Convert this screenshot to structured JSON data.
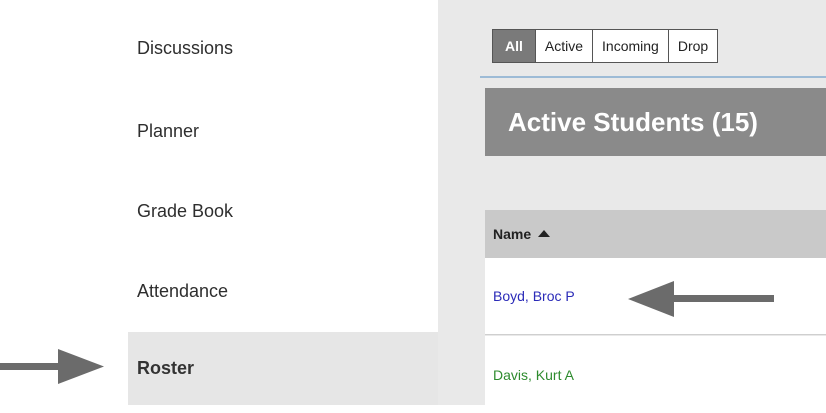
{
  "nav": {
    "items": [
      {
        "label": "Discussions",
        "active": false
      },
      {
        "label": "Planner",
        "active": false
      },
      {
        "label": "Grade Book",
        "active": false
      },
      {
        "label": "Attendance",
        "active": false
      },
      {
        "label": "Roster",
        "active": true
      }
    ]
  },
  "tabs": [
    {
      "label": "All",
      "selected": true
    },
    {
      "label": "Active",
      "selected": false
    },
    {
      "label": "Incoming",
      "selected": false
    },
    {
      "label": "Drop",
      "selected": false
    }
  ],
  "content": {
    "title": "Active Students (15)",
    "column_name": "Name",
    "rows": [
      {
        "name": "Boyd, Broc P",
        "color": "#2b2bb8"
      },
      {
        "name": "Davis, Kurt A",
        "color": "#2e8b2e"
      }
    ]
  },
  "colors": {
    "arrow": "#6b6b6b",
    "active_nav": "#e6e6e6",
    "title_bar": "#8a8a8a"
  },
  "icons": {
    "sort": "sort-ascending-icon",
    "arrow": "arrow-pointer-icon"
  }
}
